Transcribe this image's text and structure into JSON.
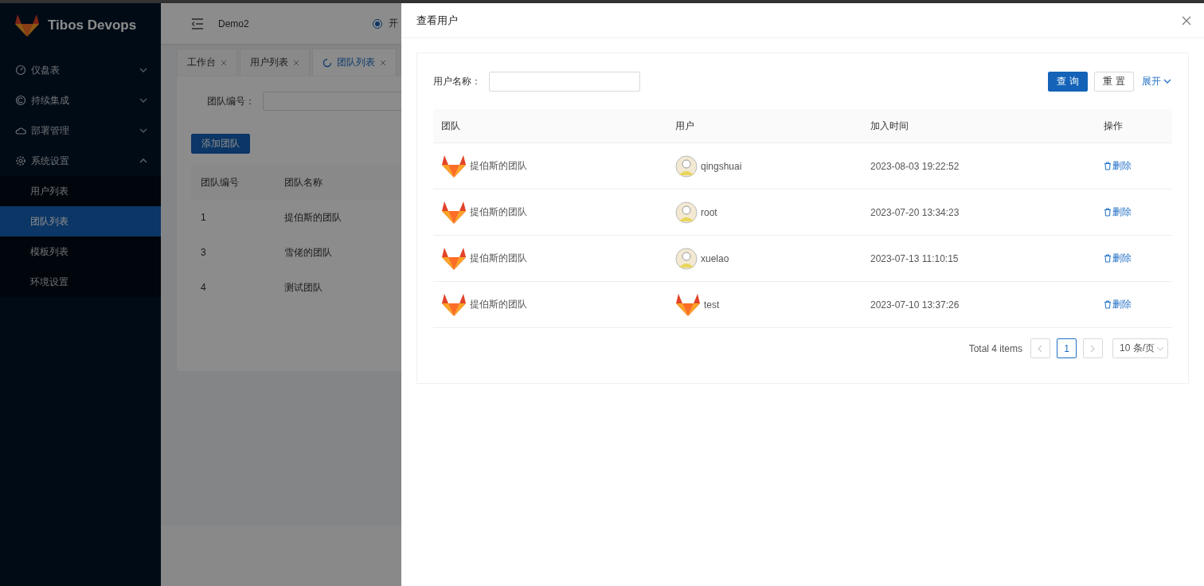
{
  "sidebar": {
    "logo_text": "Tibos Devops",
    "items": [
      {
        "label": "仪盘表",
        "expanded": false
      },
      {
        "label": "持续集成",
        "expanded": false
      },
      {
        "label": "部署管理",
        "expanded": false
      },
      {
        "label": "系统设置",
        "expanded": true,
        "children": [
          {
            "label": "用户列表",
            "selected": false
          },
          {
            "label": "团队列表",
            "selected": true
          },
          {
            "label": "模板列表",
            "selected": false
          },
          {
            "label": "环境设置",
            "selected": false
          }
        ]
      }
    ]
  },
  "header": {
    "project": "Demo2",
    "radio": {
      "label": "开",
      "selected": true
    }
  },
  "tabs": [
    {
      "label": "工作台",
      "selected": false
    },
    {
      "label": "用户列表",
      "selected": false
    },
    {
      "label": "团队列表",
      "selected": true
    }
  ],
  "page": {
    "filter_label": "团队编号：",
    "add_button": "添加团队",
    "table": {
      "columns": [
        "团队编号",
        "团队名称"
      ],
      "rows": [
        [
          "1",
          "提伯斯的团队"
        ],
        [
          "3",
          "雪佬的团队"
        ],
        [
          "4",
          "测试团队"
        ]
      ]
    }
  },
  "drawer": {
    "title": "查看用户",
    "filter_label": "用户名称：",
    "query_button": "查 询",
    "reset_button": "重 置",
    "expand_link": "展开",
    "table": {
      "columns": [
        "团队",
        "用户",
        "加入时间",
        "操作"
      ],
      "rows": [
        {
          "team": "提伯斯的团队",
          "user": "qingshuai",
          "kind": "cartoon",
          "joined": "2023-08-03 19:22:52",
          "action": "删除"
        },
        {
          "team": "提伯斯的团队",
          "user": "root",
          "kind": "cartoon",
          "joined": "2023-07-20 13:34:23",
          "action": "删除"
        },
        {
          "team": "提伯斯的团队",
          "user": "xuelao",
          "kind": "cartoon",
          "joined": "2023-07-13 11:10:15",
          "action": "删除"
        },
        {
          "team": "提伯斯的团队",
          "user": "test",
          "kind": "logo",
          "joined": "2023-07-10 13:37:26",
          "action": "删除"
        }
      ]
    },
    "pagination": {
      "total": "Total 4 items",
      "pages": [
        {
          "label": "1",
          "selected": true
        }
      ],
      "page_size": "10 条/页"
    }
  }
}
